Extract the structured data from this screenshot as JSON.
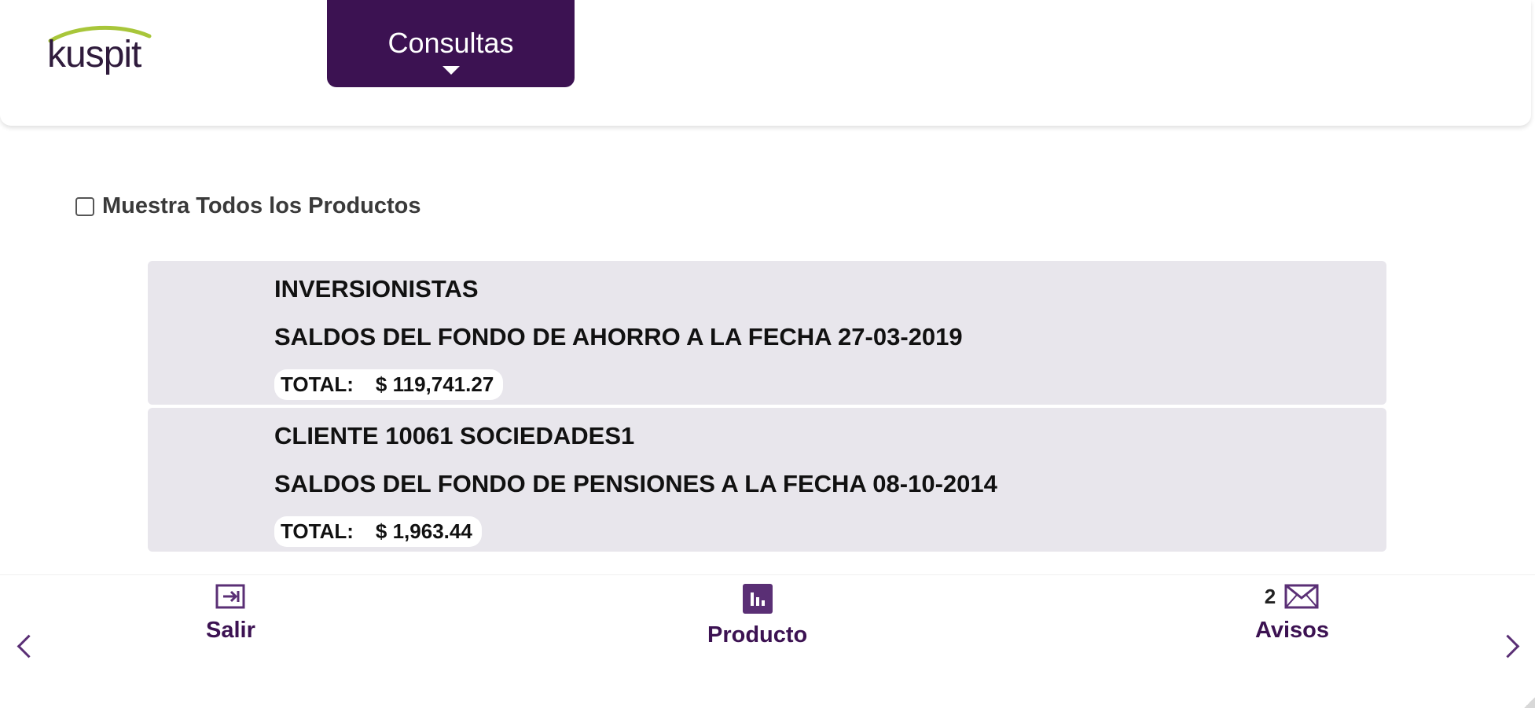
{
  "brand": {
    "logo_text": "kuspit",
    "accent_color": "#3c1252",
    "logo_swoosh_color": "#a8c63a"
  },
  "header": {
    "menu_button_label": "Consultas"
  },
  "filters": {
    "show_all_label": "Muestra Todos los Productos",
    "show_all_checked": false
  },
  "products": [
    {
      "title": "INVERSIONISTAS",
      "subtitle": "SALDOS DEL FONDO DE AHORRO A LA FECHA 27-03-2019",
      "total_label": "TOTAL:",
      "total_value": "$ 119,741.27"
    },
    {
      "title": "CLIENTE 10061 SOCIEDADES1",
      "subtitle": "SALDOS DEL FONDO DE PENSIONES A LA FECHA 08-10-2014",
      "total_label": "TOTAL:",
      "total_value": "$ 1,963.44"
    }
  ],
  "bottom_nav": {
    "salir_label": "Salir",
    "salir_icon": "exit-icon",
    "producto_label": "Producto",
    "producto_icon": "bar-chart-icon",
    "avisos_label": "Avisos",
    "avisos_icon": "mail-icon",
    "avisos_count": "2"
  }
}
